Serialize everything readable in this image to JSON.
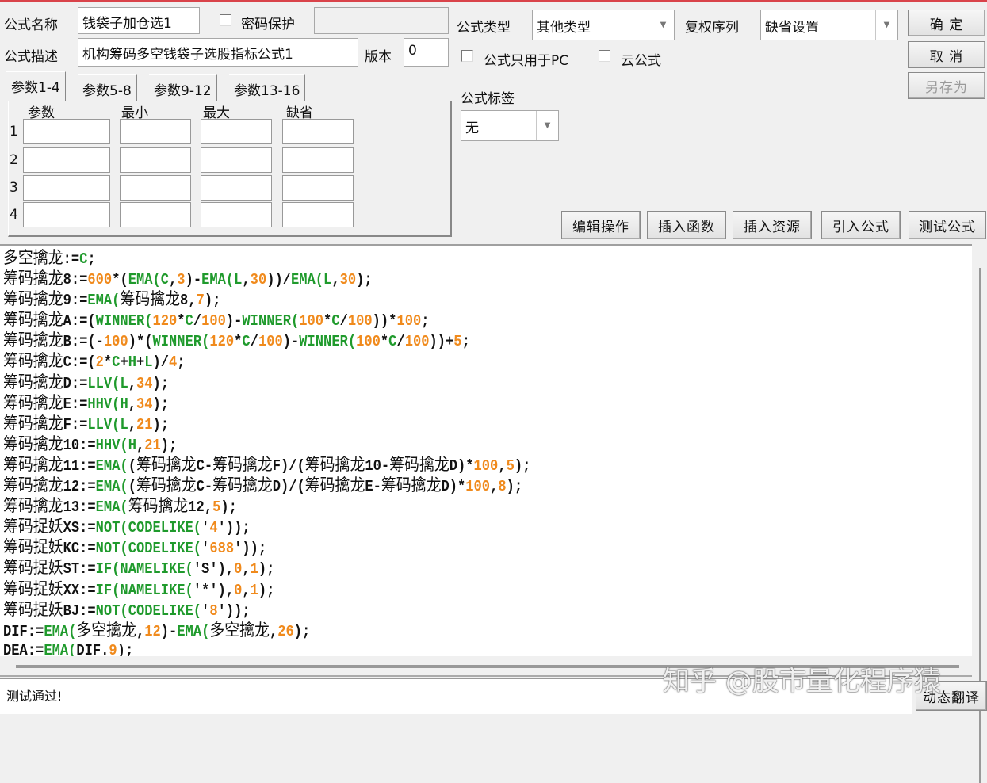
{
  "header": {
    "name_label": "公式名称",
    "name_value": "钱袋子加仓选1",
    "password_label": "密码保护",
    "password_value": "",
    "desc_label": "公式描述",
    "desc_value": "机构筹码多空钱袋子选股指标公式1",
    "version_label": "版本",
    "version_value": "0",
    "type_label": "公式类型",
    "type_value": "其他类型",
    "rights_label": "复权序列",
    "rights_value": "缺省设置",
    "pc_only_label": "公式只用于PC",
    "cloud_label": "云公式",
    "tag_label": "公式标签",
    "tag_value": "无"
  },
  "buttons": {
    "ok": "确 定",
    "cancel": "取 消",
    "save_as": "另存为",
    "edit_ops": "编辑操作",
    "insert_func": "插入函数",
    "insert_res": "插入资源",
    "import_formula": "引入公式",
    "test_formula": "测试公式",
    "dyn_translate": "动态翻译"
  },
  "tabs": [
    "参数1-4",
    "参数5-8",
    "参数9-12",
    "参数13-16"
  ],
  "params": {
    "headers": [
      "参数",
      "最小",
      "最大",
      "缺省"
    ],
    "rows": [
      "1",
      "2",
      "3",
      "4"
    ]
  },
  "code_lines": [
    [
      [
        "k",
        "多空擒龙"
      ],
      [
        "a",
        ":="
      ],
      [
        "g",
        "C"
      ],
      [
        "a",
        ";"
      ]
    ],
    [
      [
        "k",
        "筹码擒龙"
      ],
      [
        "a",
        "8:="
      ],
      [
        "o",
        "600"
      ],
      [
        "a",
        "*("
      ],
      [
        "g",
        "EMA(C"
      ],
      [
        "a",
        ","
      ],
      [
        "o",
        "3"
      ],
      [
        "a",
        ")-"
      ],
      [
        "g",
        "EMA(L"
      ],
      [
        "a",
        ","
      ],
      [
        "o",
        "30"
      ],
      [
        "a",
        "))/"
      ],
      [
        "g",
        "EMA(L"
      ],
      [
        "a",
        ","
      ],
      [
        "o",
        "30"
      ],
      [
        "a",
        ");"
      ]
    ],
    [
      [
        "k",
        "筹码擒龙"
      ],
      [
        "a",
        "9:="
      ],
      [
        "g",
        "EMA("
      ],
      [
        "k",
        "筹码擒龙"
      ],
      [
        "a",
        "8,"
      ],
      [
        "o",
        "7"
      ],
      [
        "a",
        ");"
      ]
    ],
    [
      [
        "k",
        "筹码擒龙"
      ],
      [
        "a",
        "A:=("
      ],
      [
        "g",
        "WINNER("
      ],
      [
        "o",
        "120"
      ],
      [
        "a",
        "*"
      ],
      [
        "g",
        "C"
      ],
      [
        "a",
        "/"
      ],
      [
        "o",
        "100"
      ],
      [
        "a",
        ")-"
      ],
      [
        "g",
        "WINNER("
      ],
      [
        "o",
        "100"
      ],
      [
        "a",
        "*"
      ],
      [
        "g",
        "C"
      ],
      [
        "a",
        "/"
      ],
      [
        "o",
        "100"
      ],
      [
        "a",
        "))*"
      ],
      [
        "o",
        "100"
      ],
      [
        "a",
        ";"
      ]
    ],
    [
      [
        "k",
        "筹码擒龙"
      ],
      [
        "a",
        "B:=(-"
      ],
      [
        "o",
        "100"
      ],
      [
        "a",
        ")*("
      ],
      [
        "g",
        "WINNER("
      ],
      [
        "o",
        "120"
      ],
      [
        "a",
        "*"
      ],
      [
        "g",
        "C"
      ],
      [
        "a",
        "/"
      ],
      [
        "o",
        "100"
      ],
      [
        "a",
        ")-"
      ],
      [
        "g",
        "WINNER("
      ],
      [
        "o",
        "100"
      ],
      [
        "a",
        "*"
      ],
      [
        "g",
        "C"
      ],
      [
        "a",
        "/"
      ],
      [
        "o",
        "100"
      ],
      [
        "a",
        "))+"
      ],
      [
        "o",
        "5"
      ],
      [
        "a",
        ";"
      ]
    ],
    [
      [
        "k",
        "筹码擒龙"
      ],
      [
        "a",
        "C:=("
      ],
      [
        "o",
        "2"
      ],
      [
        "a",
        "*"
      ],
      [
        "g",
        "C"
      ],
      [
        "a",
        "+"
      ],
      [
        "g",
        "H"
      ],
      [
        "a",
        "+"
      ],
      [
        "g",
        "L"
      ],
      [
        "a",
        ")/"
      ],
      [
        "o",
        "4"
      ],
      [
        "a",
        ";"
      ]
    ],
    [
      [
        "k",
        "筹码擒龙"
      ],
      [
        "a",
        "D:="
      ],
      [
        "g",
        "LLV(L"
      ],
      [
        "a",
        ","
      ],
      [
        "o",
        "34"
      ],
      [
        "a",
        ");"
      ]
    ],
    [
      [
        "k",
        "筹码擒龙"
      ],
      [
        "a",
        "E:="
      ],
      [
        "g",
        "HHV(H"
      ],
      [
        "a",
        ","
      ],
      [
        "o",
        "34"
      ],
      [
        "a",
        ");"
      ]
    ],
    [
      [
        "k",
        "筹码擒龙"
      ],
      [
        "a",
        "F:="
      ],
      [
        "g",
        "LLV(L"
      ],
      [
        "a",
        ","
      ],
      [
        "o",
        "21"
      ],
      [
        "a",
        ");"
      ]
    ],
    [
      [
        "k",
        "筹码擒龙"
      ],
      [
        "a",
        "10:="
      ],
      [
        "g",
        "HHV(H"
      ],
      [
        "a",
        ","
      ],
      [
        "o",
        "21"
      ],
      [
        "a",
        ");"
      ]
    ],
    [
      [
        "k",
        "筹码擒龙"
      ],
      [
        "a",
        "11:="
      ],
      [
        "g",
        "EMA("
      ],
      [
        "a",
        "("
      ],
      [
        "k",
        "筹码擒龙"
      ],
      [
        "a",
        "C-"
      ],
      [
        "k",
        "筹码擒龙"
      ],
      [
        "a",
        "F)/("
      ],
      [
        "k",
        "筹码擒龙"
      ],
      [
        "a",
        "10-"
      ],
      [
        "k",
        "筹码擒龙"
      ],
      [
        "a",
        "D)*"
      ],
      [
        "o",
        "100"
      ],
      [
        "a",
        ","
      ],
      [
        "o",
        "5"
      ],
      [
        "a",
        ");"
      ]
    ],
    [
      [
        "k",
        "筹码擒龙"
      ],
      [
        "a",
        "12:="
      ],
      [
        "g",
        "EMA("
      ],
      [
        "a",
        "("
      ],
      [
        "k",
        "筹码擒龙"
      ],
      [
        "a",
        "C-"
      ],
      [
        "k",
        "筹码擒龙"
      ],
      [
        "a",
        "D)/("
      ],
      [
        "k",
        "筹码擒龙"
      ],
      [
        "a",
        "E-"
      ],
      [
        "k",
        "筹码擒龙"
      ],
      [
        "a",
        "D)*"
      ],
      [
        "o",
        "100"
      ],
      [
        "a",
        ","
      ],
      [
        "o",
        "8"
      ],
      [
        "a",
        ");"
      ]
    ],
    [
      [
        "k",
        "筹码擒龙"
      ],
      [
        "a",
        "13:="
      ],
      [
        "g",
        "EMA("
      ],
      [
        "k",
        "筹码擒龙"
      ],
      [
        "a",
        "12,"
      ],
      [
        "o",
        "5"
      ],
      [
        "a",
        ");"
      ]
    ],
    [
      [
        "k",
        "筹码捉妖"
      ],
      [
        "a",
        "XS:="
      ],
      [
        "g",
        "NOT(CODELIKE("
      ],
      [
        "a",
        "'"
      ],
      [
        "o",
        "4"
      ],
      [
        "a",
        "'));"
      ]
    ],
    [
      [
        "k",
        "筹码捉妖"
      ],
      [
        "a",
        "KC:="
      ],
      [
        "g",
        "NOT(CODELIKE("
      ],
      [
        "a",
        "'"
      ],
      [
        "o",
        "688"
      ],
      [
        "a",
        "'));"
      ]
    ],
    [
      [
        "k",
        "筹码捉妖"
      ],
      [
        "a",
        "ST:="
      ],
      [
        "g",
        "IF(NAMELIKE("
      ],
      [
        "a",
        "'S'),"
      ],
      [
        "o",
        "0"
      ],
      [
        "a",
        ","
      ],
      [
        "o",
        "1"
      ],
      [
        "a",
        ");"
      ]
    ],
    [
      [
        "k",
        "筹码捉妖"
      ],
      [
        "a",
        "XX:="
      ],
      [
        "g",
        "IF(NAMELIKE("
      ],
      [
        "a",
        "'*'),"
      ],
      [
        "o",
        "0"
      ],
      [
        "a",
        ","
      ],
      [
        "o",
        "1"
      ],
      [
        "a",
        ");"
      ]
    ],
    [
      [
        "k",
        "筹码捉妖"
      ],
      [
        "a",
        "BJ:="
      ],
      [
        "g",
        "NOT(CODELIKE("
      ],
      [
        "a",
        "'"
      ],
      [
        "o",
        "8"
      ],
      [
        "a",
        "'));"
      ]
    ],
    [
      [
        "a",
        "DIF:="
      ],
      [
        "g",
        "EMA("
      ],
      [
        "k",
        "多空擒龙"
      ],
      [
        "a",
        ","
      ],
      [
        "o",
        "12"
      ],
      [
        "a",
        ")-"
      ],
      [
        "g",
        "EMA("
      ],
      [
        "k",
        "多空擒龙"
      ],
      [
        "a",
        ","
      ],
      [
        "o",
        "26"
      ],
      [
        "a",
        ");"
      ]
    ],
    [
      [
        "a",
        "DEA:="
      ],
      [
        "g",
        "EMA("
      ],
      [
        "a",
        "DIF."
      ],
      [
        "o",
        "9"
      ],
      [
        "a",
        ");"
      ]
    ]
  ],
  "status": "测试通过!",
  "watermark": "知乎 @股市量化程序猿",
  "colors": {
    "function": "#1f9a2c",
    "number": "#f08a1c",
    "accent": "#d9434a"
  }
}
